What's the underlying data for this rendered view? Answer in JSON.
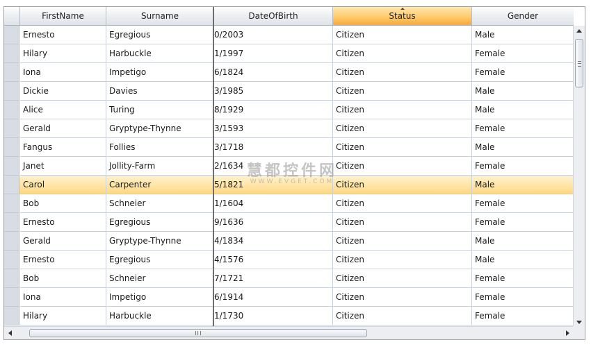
{
  "grid": {
    "columns": [
      {
        "key": "firstname",
        "label": "FirstName"
      },
      {
        "key": "surname",
        "label": "Surname"
      },
      {
        "key": "dob",
        "label": "DateOfBirth"
      },
      {
        "key": "status",
        "label": "Status",
        "sorted": "ascending"
      },
      {
        "key": "gender",
        "label": "Gender"
      }
    ],
    "selected_row": 8,
    "rows": [
      {
        "firstname": "Ernesto",
        "surname": "Egregious",
        "dob": "0/2003",
        "status": "Citizen",
        "gender": "Male"
      },
      {
        "firstname": "Hilary",
        "surname": "Harbuckle",
        "dob": "1/1997",
        "status": "Citizen",
        "gender": "Female"
      },
      {
        "firstname": "Iona",
        "surname": "Impetigo",
        "dob": "6/1824",
        "status": "Citizen",
        "gender": "Female"
      },
      {
        "firstname": "Dickie",
        "surname": "Davies",
        "dob": "3/1985",
        "status": "Citizen",
        "gender": "Male"
      },
      {
        "firstname": "Alice",
        "surname": "Turing",
        "dob": "8/1929",
        "status": "Citizen",
        "gender": "Male"
      },
      {
        "firstname": "Gerald",
        "surname": "Gryptype-Thynne",
        "dob": "3/1593",
        "status": "Citizen",
        "gender": "Female"
      },
      {
        "firstname": "Fangus",
        "surname": "Follies",
        "dob": "3/1718",
        "status": "Citizen",
        "gender": "Male"
      },
      {
        "firstname": "Janet",
        "surname": "Jollity-Farm",
        "dob": "2/1634",
        "status": "Citizen",
        "gender": "Female"
      },
      {
        "firstname": "Carol",
        "surname": "Carpenter",
        "dob": "5/1821",
        "status": "Citizen",
        "gender": "Male"
      },
      {
        "firstname": "Bob",
        "surname": "Schneier",
        "dob": "1/1604",
        "status": "Citizen",
        "gender": "Female"
      },
      {
        "firstname": "Ernesto",
        "surname": "Egregious",
        "dob": "9/1636",
        "status": "Citizen",
        "gender": "Female"
      },
      {
        "firstname": "Gerald",
        "surname": "Gryptype-Thynne",
        "dob": "4/1834",
        "status": "Citizen",
        "gender": "Male"
      },
      {
        "firstname": "Ernesto",
        "surname": "Egregious",
        "dob": "4/1576",
        "status": "Citizen",
        "gender": "Male"
      },
      {
        "firstname": "Bob",
        "surname": "Schneier",
        "dob": "7/1721",
        "status": "Citizen",
        "gender": "Female"
      },
      {
        "firstname": "Iona",
        "surname": "Impetigo",
        "dob": "6/1914",
        "status": "Citizen",
        "gender": "Female"
      },
      {
        "firstname": "Hilary",
        "surname": "Harbuckle",
        "dob": "1/1730",
        "status": "Citizen",
        "gender": "Female"
      }
    ]
  },
  "watermark": {
    "text_cn": "慧都控件网",
    "url": "WWW.EVGET.COM"
  },
  "colors": {
    "sorted_header": "#ffcb6b",
    "selected_row": "#ffe2a0"
  }
}
